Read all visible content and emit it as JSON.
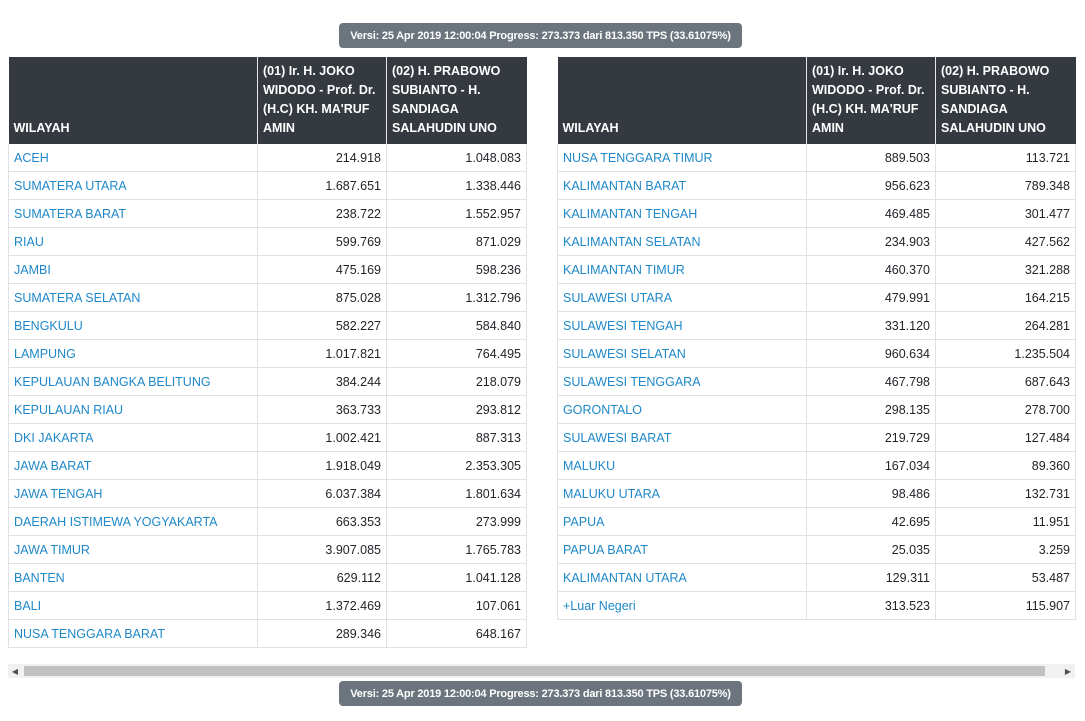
{
  "version_badge": "Versi: 25 Apr 2019 12:00:04 Progress: 273.373 dari 813.350 TPS (33.61075%)",
  "headers": {
    "wilayah": "WILAYAH",
    "candidate1": "(01) Ir. H. JOKO WIDODO - Prof. Dr. (H.C) KH. MA'RUF AMIN",
    "candidate2": "(02) H. PRABOWO SUBIANTO - H. SANDIAGA SALAHUDIN UNO"
  },
  "left_table": [
    {
      "region": "ACEH",
      "c1": "214.918",
      "c2": "1.048.083"
    },
    {
      "region": "SUMATERA UTARA",
      "c1": "1.687.651",
      "c2": "1.338.446"
    },
    {
      "region": "SUMATERA BARAT",
      "c1": "238.722",
      "c2": "1.552.957"
    },
    {
      "region": "RIAU",
      "c1": "599.769",
      "c2": "871.029"
    },
    {
      "region": "JAMBI",
      "c1": "475.169",
      "c2": "598.236"
    },
    {
      "region": "SUMATERA SELATAN",
      "c1": "875.028",
      "c2": "1.312.796"
    },
    {
      "region": "BENGKULU",
      "c1": "582.227",
      "c2": "584.840"
    },
    {
      "region": "LAMPUNG",
      "c1": "1.017.821",
      "c2": "764.495"
    },
    {
      "region": "KEPULAUAN BANGKA BELITUNG",
      "c1": "384.244",
      "c2": "218.079"
    },
    {
      "region": "KEPULAUAN RIAU",
      "c1": "363.733",
      "c2": "293.812"
    },
    {
      "region": "DKI JAKARTA",
      "c1": "1.002.421",
      "c2": "887.313"
    },
    {
      "region": "JAWA BARAT",
      "c1": "1.918.049",
      "c2": "2.353.305"
    },
    {
      "region": "JAWA TENGAH",
      "c1": "6.037.384",
      "c2": "1.801.634"
    },
    {
      "region": "DAERAH ISTIMEWA YOGYAKARTA",
      "c1": "663.353",
      "c2": "273.999"
    },
    {
      "region": "JAWA TIMUR",
      "c1": "3.907.085",
      "c2": "1.765.783"
    },
    {
      "region": "BANTEN",
      "c1": "629.112",
      "c2": "1.041.128"
    },
    {
      "region": "BALI",
      "c1": "1.372.469",
      "c2": "107.061"
    },
    {
      "region": "NUSA TENGGARA BARAT",
      "c1": "289.346",
      "c2": "648.167"
    }
  ],
  "right_table": [
    {
      "region": "NUSA TENGGARA TIMUR",
      "c1": "889.503",
      "c2": "113.721"
    },
    {
      "region": "KALIMANTAN BARAT",
      "c1": "956.623",
      "c2": "789.348"
    },
    {
      "region": "KALIMANTAN TENGAH",
      "c1": "469.485",
      "c2": "301.477"
    },
    {
      "region": "KALIMANTAN SELATAN",
      "c1": "234.903",
      "c2": "427.562"
    },
    {
      "region": "KALIMANTAN TIMUR",
      "c1": "460.370",
      "c2": "321.288"
    },
    {
      "region": "SULAWESI UTARA",
      "c1": "479.991",
      "c2": "164.215"
    },
    {
      "region": "SULAWESI TENGAH",
      "c1": "331.120",
      "c2": "264.281"
    },
    {
      "region": "SULAWESI SELATAN",
      "c1": "960.634",
      "c2": "1.235.504"
    },
    {
      "region": "SULAWESI TENGGARA",
      "c1": "467.798",
      "c2": "687.643"
    },
    {
      "region": "GORONTALO",
      "c1": "298.135",
      "c2": "278.700"
    },
    {
      "region": "SULAWESI BARAT",
      "c1": "219.729",
      "c2": "127.484"
    },
    {
      "region": "MALUKU",
      "c1": "167.034",
      "c2": "89.360"
    },
    {
      "region": "MALUKU UTARA",
      "c1": "98.486",
      "c2": "132.731"
    },
    {
      "region": "PAPUA",
      "c1": "42.695",
      "c2": "11.951"
    },
    {
      "region": "PAPUA BARAT",
      "c1": "25.035",
      "c2": "3.259"
    },
    {
      "region": "KALIMANTAN UTARA",
      "c1": "129.311",
      "c2": "53.487"
    },
    {
      "region": "+Luar Negeri",
      "c1": "313.523",
      "c2": "115.907"
    }
  ],
  "scrollbar": {
    "left_arrow_icon": "triangle-left-icon",
    "right_arrow_icon": "triangle-right-icon"
  }
}
